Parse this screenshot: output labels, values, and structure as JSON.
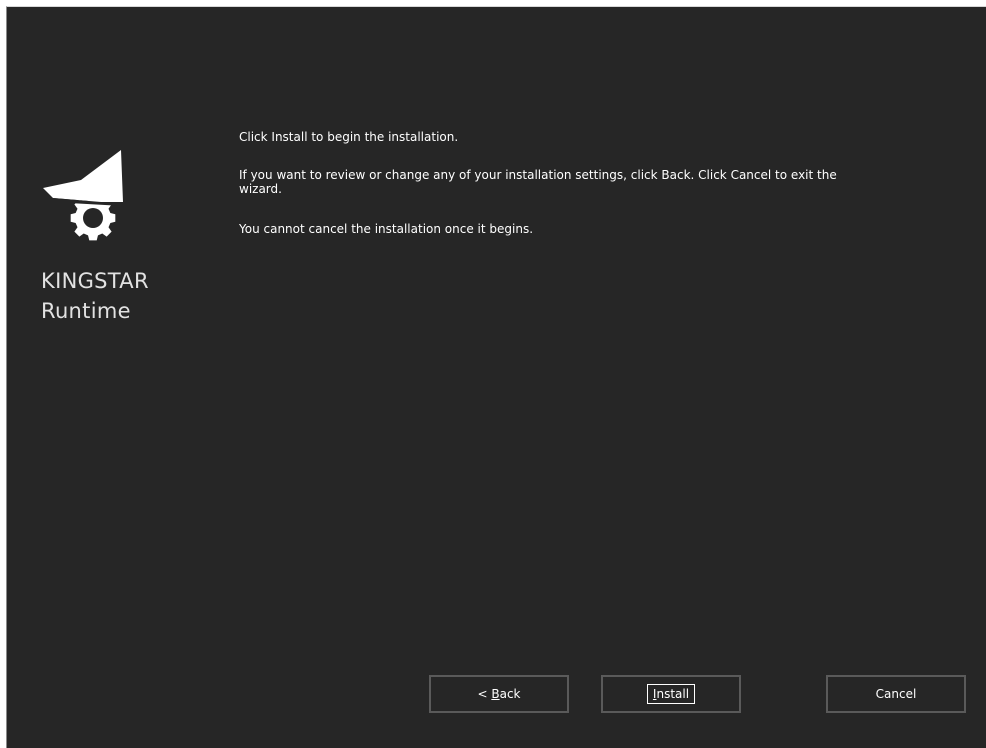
{
  "brand": {
    "line1": "KINGSTAR",
    "line2": "Runtime",
    "logo_icon": "crown-gear-icon",
    "logo_color": "#ffffff"
  },
  "content": {
    "line1": "Click Install to begin the installation.",
    "line2": "If you want to review or change any of your installation settings, click Back. Click Cancel to exit the wizard.",
    "line3": "You cannot cancel the installation once it begins."
  },
  "buttons": {
    "back_prefix": "< ",
    "back_accel": "B",
    "back_rest": "ack",
    "install_accel": "I",
    "install_rest": "nstall",
    "cancel_label": "Cancel"
  },
  "colors": {
    "background": "#262626",
    "text": "#ffffff",
    "button_border": "#5a5a5a"
  }
}
